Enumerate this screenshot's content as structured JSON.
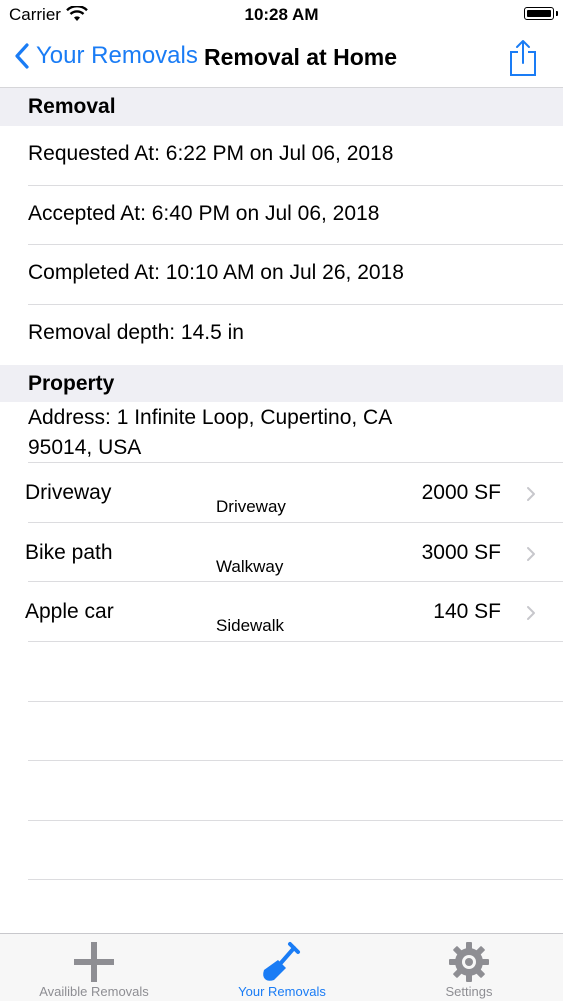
{
  "status": {
    "carrier": "Carrier",
    "time": "10:28 AM"
  },
  "nav": {
    "back_label": "Your Removals",
    "title": "Removal at Home"
  },
  "removal_section": {
    "header": "Removal",
    "rows": [
      "Requested At: 6:22 PM on Jul 06, 2018",
      "Accepted At: 6:40 PM on Jul 06, 2018",
      "Completed At: 10:10 AM on Jul 26, 2018",
      "Removal depth: 14.5 in"
    ]
  },
  "property_section": {
    "header": "Property",
    "address": "Address: 1 Infinite Loop, Cupertino, CA 95014, USA",
    "areas": [
      {
        "name": "Driveway",
        "type": "Driveway",
        "size": "2000 SF"
      },
      {
        "name": "Bike path",
        "type": "Walkway",
        "size": "3000 SF"
      },
      {
        "name": "Apple car",
        "type": "Sidewalk",
        "size": "140 SF"
      }
    ]
  },
  "tabbar": {
    "tabs": [
      {
        "label": "Availible Removals",
        "icon": "plus-icon"
      },
      {
        "label": "Your Removals",
        "icon": "shovel-icon",
        "active": true
      },
      {
        "label": "Settings",
        "icon": "gear-icon"
      }
    ]
  },
  "colors": {
    "accent": "#1a7cf5",
    "section_bg": "#efeff4",
    "inactive_tab": "#8e8e93"
  }
}
